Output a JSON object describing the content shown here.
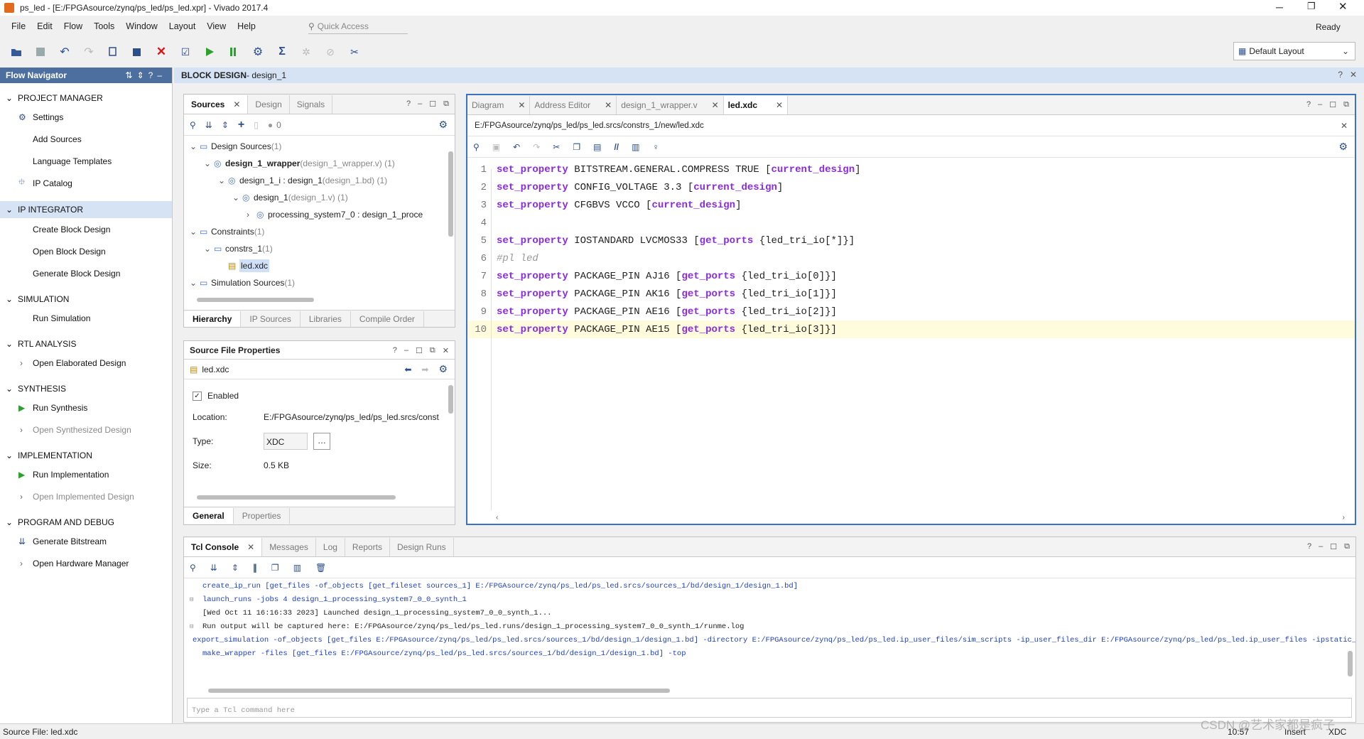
{
  "window": {
    "title": "ps_led - [E:/FPGAsource/zynq/ps_led/ps_led.xpr] - Vivado 2017.4",
    "status": "Ready"
  },
  "menu": [
    "File",
    "Edit",
    "Flow",
    "Tools",
    "Window",
    "Layout",
    "View",
    "Help"
  ],
  "quick_access": {
    "placeholder": "Quick Access"
  },
  "layout_select": {
    "value": "Default Layout"
  },
  "flow_navigator": {
    "title": "Flow Navigator",
    "sections": [
      {
        "label": "PROJECT MANAGER",
        "items": [
          {
            "label": "Settings",
            "icon": "gear-icon"
          },
          {
            "label": "Add Sources"
          },
          {
            "label": "Language Templates"
          },
          {
            "label": "IP Catalog",
            "icon": "plug-icon"
          }
        ]
      },
      {
        "label": "IP INTEGRATOR",
        "items": [
          {
            "label": "Create Block Design"
          },
          {
            "label": "Open Block Design"
          },
          {
            "label": "Generate Block Design"
          }
        ]
      },
      {
        "label": "SIMULATION",
        "items": [
          {
            "label": "Run Simulation"
          }
        ]
      },
      {
        "label": "RTL ANALYSIS",
        "items": [
          {
            "label": "Open Elaborated Design",
            "chev": true
          }
        ]
      },
      {
        "label": "SYNTHESIS",
        "items": [
          {
            "label": "Run Synthesis",
            "icon": "play-icon"
          },
          {
            "label": "Open Synthesized Design",
            "chev": true,
            "dim": true
          }
        ]
      },
      {
        "label": "IMPLEMENTATION",
        "items": [
          {
            "label": "Run Implementation",
            "icon": "play-icon"
          },
          {
            "label": "Open Implemented Design",
            "chev": true,
            "dim": true
          }
        ]
      },
      {
        "label": "PROGRAM AND DEBUG",
        "items": [
          {
            "label": "Generate Bitstream",
            "icon": "bitstream-icon"
          },
          {
            "label": "Open Hardware Manager",
            "chev": true
          }
        ]
      }
    ]
  },
  "block_design": {
    "prefix": "BLOCK DESIGN",
    "name": " - design_1"
  },
  "sources": {
    "tabs": [
      "Sources",
      "Design",
      "Signals"
    ],
    "tree": [
      {
        "label": "Design Sources",
        "extra": " (1)",
        "depth": 0
      },
      {
        "label": "design_1_wrapper",
        "extra": " (design_1_wrapper.v) (1)",
        "depth": 1,
        "bold": true
      },
      {
        "label": "design_1_i : design_1",
        "extra": " (design_1.bd) (1)",
        "depth": 2
      },
      {
        "label": "design_1",
        "extra": " (design_1.v) (1)",
        "depth": 3
      },
      {
        "label": "processing_system7_0 : design_1_proce",
        "extra": "",
        "depth": 4
      },
      {
        "label": "Constraints",
        "extra": " (1)",
        "depth": 0
      },
      {
        "label": "constrs_1",
        "extra": " (1)",
        "depth": 1
      },
      {
        "label": "led.xdc",
        "extra": "",
        "depth": 2,
        "selected": true
      },
      {
        "label": "Simulation Sources",
        "extra": " (1)",
        "depth": 0
      }
    ],
    "count": "0",
    "bottom_tabs": [
      "Hierarchy",
      "IP Sources",
      "Libraries",
      "Compile Order"
    ]
  },
  "file_props": {
    "title": "Source File Properties",
    "file": "led.xdc",
    "enabled_label": "Enabled",
    "location_label": "Location:",
    "location": "E:/FPGAsource/zynq/ps_led/ps_led.srcs/const",
    "type_label": "Type:",
    "type": "XDC",
    "size_label": "Size:",
    "size": "0.5 KB",
    "tabs": [
      "General",
      "Properties"
    ]
  },
  "editor": {
    "tabs": [
      "Diagram",
      "Address Editor",
      "design_1_wrapper.v",
      "led.xdc"
    ],
    "path": "E:/FPGAsource/zynq/ps_led/ps_led.srcs/constrs_1/new/led.xdc",
    "lines": [
      {
        "n": "1",
        "kw": "set_property",
        "rest": " BITSTREAM.GENERAL.COMPRESS TRUE [",
        "fn": "current_design",
        "tail": "]"
      },
      {
        "n": "2",
        "kw": "set_property",
        "rest": " CONFIG_VOLTAGE 3.3 [",
        "fn": "current_design",
        "tail": "]"
      },
      {
        "n": "3",
        "kw": "set_property",
        "rest": " CFGBVS VCCO [",
        "fn": "current_design",
        "tail": "]"
      },
      {
        "n": "4",
        "kw": "",
        "rest": "",
        "fn": "",
        "tail": ""
      },
      {
        "n": "5",
        "kw": "set_property",
        "rest": " IOSTANDARD LVCMOS33 [",
        "fn": "get_ports",
        "tail": " {led_tri_io[*]}]"
      },
      {
        "n": "6",
        "kw": "",
        "rest": "",
        "fn": "",
        "tail": "",
        "comment": "#pl led"
      },
      {
        "n": "7",
        "kw": "set_property",
        "rest": " PACKAGE_PIN AJ16 [",
        "fn": "get_ports",
        "tail": " {led_tri_io[0]}]"
      },
      {
        "n": "8",
        "kw": "set_property",
        "rest": " PACKAGE_PIN AK16 [",
        "fn": "get_ports",
        "tail": " {led_tri_io[1]}]"
      },
      {
        "n": "9",
        "kw": "set_property",
        "rest": " PACKAGE_PIN AE16 [",
        "fn": "get_ports",
        "tail": " {led_tri_io[2]}]"
      },
      {
        "n": "10",
        "kw": "set_property",
        "rest": " PACKAGE_PIN AE15 [",
        "fn": "get_ports",
        "tail": " {led_tri_io[3]}]"
      }
    ]
  },
  "console": {
    "tabs": [
      "Tcl Console",
      "Messages",
      "Log",
      "Reports",
      "Design Runs"
    ],
    "lines": [
      {
        "t": "create_ip_run [get_files -of_objects [get_fileset sources_1] E:/FPGAsource/zynq/ps_led/ps_led.srcs/sources_1/bd/design_1/design_1.bd]",
        "c": "blue"
      },
      {
        "t": "launch_runs -jobs 4 design_1_processing_system7_0_0_synth_1",
        "c": "blue"
      },
      {
        "t": "[Wed Oct 11 16:16:33 2023] Launched design_1_processing_system7_0_0_synth_1...",
        "c": ""
      },
      {
        "t": "Run output will be captured here: E:/FPGAsource/zynq/ps_led/ps_led.runs/design_1_processing_system7_0_0_synth_1/runme.log",
        "c": ""
      },
      {
        "t": "export_simulation -of_objects [get_files E:/FPGAsource/zynq/ps_led/ps_led.srcs/sources_1/bd/design_1/design_1.bd] -directory E:/FPGAsource/zynq/ps_led/ps_led.ip_user_files/sim_scripts -ip_user_files_dir E:/FPGAsource/zynq/ps_led/ps_led.ip_user_files -ipstatic_sourc",
        "c": "blue"
      },
      {
        "t": "make_wrapper -files [get_files E:/FPGAsource/zynq/ps_led/ps_led.srcs/sources_1/bd/design_1/design_1.bd] -top",
        "c": "blue"
      }
    ],
    "input_placeholder": "Type a Tcl command here"
  },
  "statusbar": {
    "left": "Source File: led.xdc",
    "pos": "10:57",
    "mode": "Insert",
    "type": "XDC"
  },
  "watermark": "CSDN @艺术家都是疯子"
}
